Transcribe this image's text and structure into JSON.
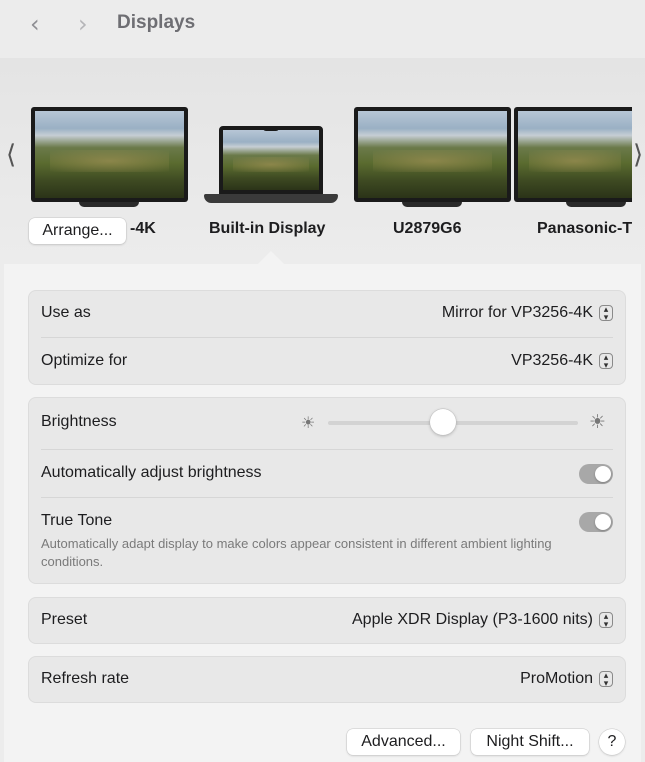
{
  "header": {
    "title": "Displays",
    "back_icon": "chevron-left-icon",
    "forward_icon": "chevron-right-icon"
  },
  "display_strip": {
    "prev_icon": "chevron-left-icon",
    "next_icon": "chevron-right-icon",
    "arrange_label": "Arrange...",
    "displays": [
      {
        "label": "-4K"
      },
      {
        "label": "Built-in Display"
      },
      {
        "label": "U2879G6"
      },
      {
        "label": "Panasonic-T"
      }
    ],
    "selected": "Built-in Display"
  },
  "settings": {
    "use_as": {
      "label": "Use as",
      "value": "Mirror for VP3256-4K"
    },
    "optimize_for": {
      "label": "Optimize for",
      "value": "VP3256-4K"
    },
    "brightness": {
      "label": "Brightness",
      "level_fraction": 0.46
    },
    "auto_brightness": {
      "label": "Automatically adjust brightness",
      "on": true
    },
    "true_tone": {
      "label": "True Tone",
      "description": "Automatically adapt display to make colors appear consistent in different ambient lighting conditions.",
      "on": true
    },
    "preset": {
      "label": "Preset",
      "value": "Apple XDR Display (P3-1600 nits)"
    },
    "refresh_rate": {
      "label": "Refresh rate",
      "value": "ProMotion"
    }
  },
  "footer": {
    "advanced_label": "Advanced...",
    "night_shift_label": "Night Shift...",
    "help_label": "?"
  }
}
